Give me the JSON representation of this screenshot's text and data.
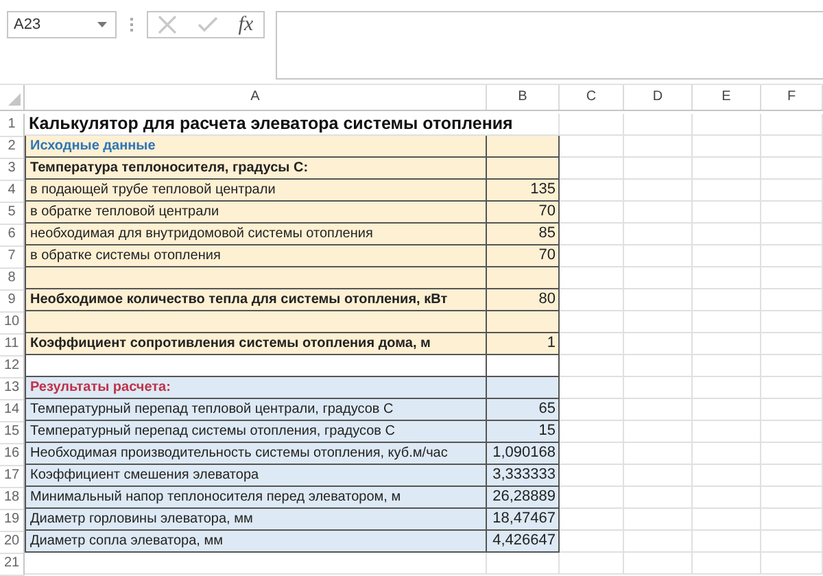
{
  "name_box": {
    "value": "A23"
  },
  "formula_bar": {
    "function_label": "fx"
  },
  "columns": [
    "A",
    "B",
    "C",
    "D",
    "E",
    "F"
  ],
  "rows": [
    {
      "number": "1",
      "kind": "title",
      "boxed": false,
      "a": "Калькулятор для расчета элеватора системы отопления"
    },
    {
      "number": "2",
      "kind": "input-heading",
      "boxed": true,
      "color": "#fdf0d3",
      "a": "Исходные данные"
    },
    {
      "number": "3",
      "kind": "bold",
      "boxed": true,
      "color": "#fdf0d3",
      "a": "Температура теплоносителя, градусы С:"
    },
    {
      "number": "4",
      "kind": "normal",
      "boxed": true,
      "color": "#fdf0d3",
      "a": "в подающей трубе тепловой централи",
      "b": "135"
    },
    {
      "number": "5",
      "kind": "normal",
      "boxed": true,
      "color": "#fdf0d3",
      "a": "в обратке тепловой централи",
      "b": "70"
    },
    {
      "number": "6",
      "kind": "normal",
      "boxed": true,
      "color": "#fdf0d3",
      "a": "необходимая для внутридомовой системы отопления",
      "b": "85"
    },
    {
      "number": "7",
      "kind": "normal",
      "boxed": true,
      "color": "#fdf0d3",
      "a": "в обратке системы отопления",
      "b": "70"
    },
    {
      "number": "8",
      "kind": "normal",
      "boxed": true,
      "color": "#fdf0d3"
    },
    {
      "number": "9",
      "kind": "bold",
      "boxed": true,
      "color": "#fdf0d3",
      "a": "Необходимое количество тепла для системы отопления, кВт",
      "b": "80"
    },
    {
      "number": "10",
      "kind": "normal",
      "boxed": true,
      "color": "#fdf0d3"
    },
    {
      "number": "11",
      "kind": "bold",
      "boxed": true,
      "color": "#fdf0d3",
      "a": "Коэффициент сопротивления системы отопления дома, м",
      "b": "1"
    },
    {
      "number": "12",
      "kind": "normal",
      "boxed": true
    },
    {
      "number": "13",
      "kind": "result-heading",
      "boxed": true,
      "color": "#dde9f4",
      "a": "Результаты расчета:"
    },
    {
      "number": "14",
      "kind": "normal",
      "boxed": true,
      "color": "#dde9f4",
      "a": "Температурный перепад тепловой централи, градусов С",
      "b": "65"
    },
    {
      "number": "15",
      "kind": "normal",
      "boxed": true,
      "color": "#dde9f4",
      "a": "Температурный перепад системы отопления, градусов С",
      "b": "15"
    },
    {
      "number": "16",
      "kind": "normal",
      "boxed": true,
      "color": "#dde9f4",
      "a": "Необходимая производительность системы отопления, куб.м/час",
      "b": "1,090168"
    },
    {
      "number": "17",
      "kind": "normal",
      "boxed": true,
      "color": "#dde9f4",
      "a": "Коэффициент смешения элеватора",
      "b": "3,333333"
    },
    {
      "number": "18",
      "kind": "normal",
      "boxed": true,
      "color": "#dde9f4",
      "a": "Минимальный напор теплоносителя перед элеватором, м",
      "b": "26,28889"
    },
    {
      "number": "19",
      "kind": "normal",
      "boxed": true,
      "color": "#dde9f4",
      "a": "Диаметр горловины элеватора, мм",
      "b": "18,47467"
    },
    {
      "number": "20",
      "kind": "normal",
      "boxed": true,
      "color": "#dde9f4",
      "a": "Диаметр сопла элеватора, мм",
      "b": "4,426647"
    },
    {
      "number": "21",
      "kind": "normal",
      "boxed": false
    }
  ]
}
